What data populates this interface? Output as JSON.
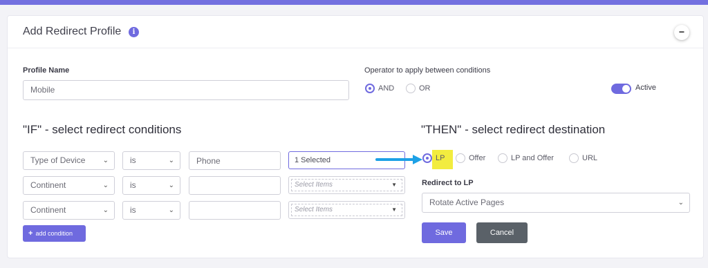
{
  "header": {
    "title": "Add Redirect Profile",
    "info_icon": "info-icon",
    "collapse_label": "−"
  },
  "profile": {
    "label": "Profile Name",
    "value": "Mobile"
  },
  "operator": {
    "label": "Operator to apply between conditions",
    "options": [
      "AND",
      "OR"
    ],
    "selected": "AND"
  },
  "active": {
    "label": "Active",
    "on": true
  },
  "if_section": {
    "title": "\"IF\" - select redirect conditions",
    "rows": [
      {
        "field": "Type of Device",
        "operator": "is",
        "value": "Phone",
        "selection": "1 Selected"
      },
      {
        "field": "Continent",
        "operator": "is",
        "value": "",
        "selection": "Select Items"
      },
      {
        "field": "Continent",
        "operator": "is",
        "value": "",
        "selection": "Select Items"
      }
    ],
    "add_button": "add condition"
  },
  "then_section": {
    "title": "\"THEN\" - select redirect destination",
    "options": [
      "LP",
      "Offer",
      "LP and Offer",
      "URL"
    ],
    "selected": "LP",
    "redirect_label": "Redirect to LP",
    "redirect_value": "Rotate Active Pages"
  },
  "buttons": {
    "save": "Save",
    "cancel": "Cancel"
  },
  "colors": {
    "accent": "#6f6adf",
    "highlight": "#f2ec3f",
    "arrow": "#1da1e6",
    "cancel": "#5a6168"
  }
}
